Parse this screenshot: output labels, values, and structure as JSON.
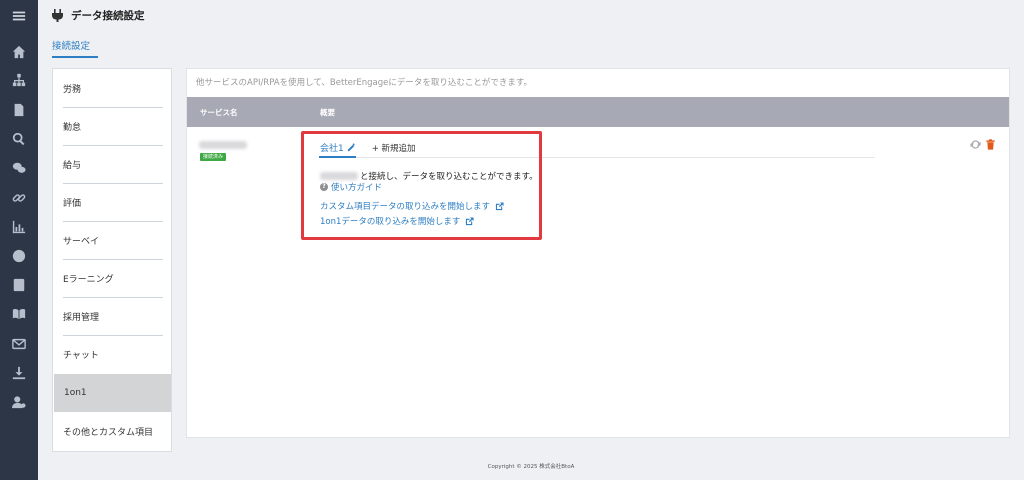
{
  "header": {
    "title": "データ接続設定"
  },
  "tabs": [
    {
      "label": "接続設定",
      "active": true
    }
  ],
  "categories": [
    {
      "label": "労務"
    },
    {
      "label": "勤怠"
    },
    {
      "label": "給与"
    },
    {
      "label": "評価"
    },
    {
      "label": "サーベイ"
    },
    {
      "label": "Eラーニング"
    },
    {
      "label": "採用管理"
    },
    {
      "label": "チャット"
    },
    {
      "label": "1on1",
      "active": true
    },
    {
      "label": "その他とカスタム項目"
    }
  ],
  "main": {
    "description": "他サービスのAPI/RPAを使用して、BetterEngageにデータを取り込むことができます。",
    "columns": [
      "サービス名",
      "概要"
    ],
    "service": {
      "status_badge": "接続済み"
    },
    "subtabs": {
      "company": "会社1",
      "add_new": "+ 新規追加"
    },
    "connect_text": "と接続し、データを取り込むことができます。",
    "guide_link": "使い方ガイド",
    "links": [
      "カスタム項目データの取り込みを開始します",
      "1on1データの取り込みを開始します"
    ]
  },
  "colors": {
    "accent": "#2d7ec2",
    "highlight": "#e0393e",
    "delete": "#e35a1c",
    "badge": "#3ea844"
  },
  "footer": {
    "copyright": "Copyright © 2025 株式会社BtoA"
  }
}
